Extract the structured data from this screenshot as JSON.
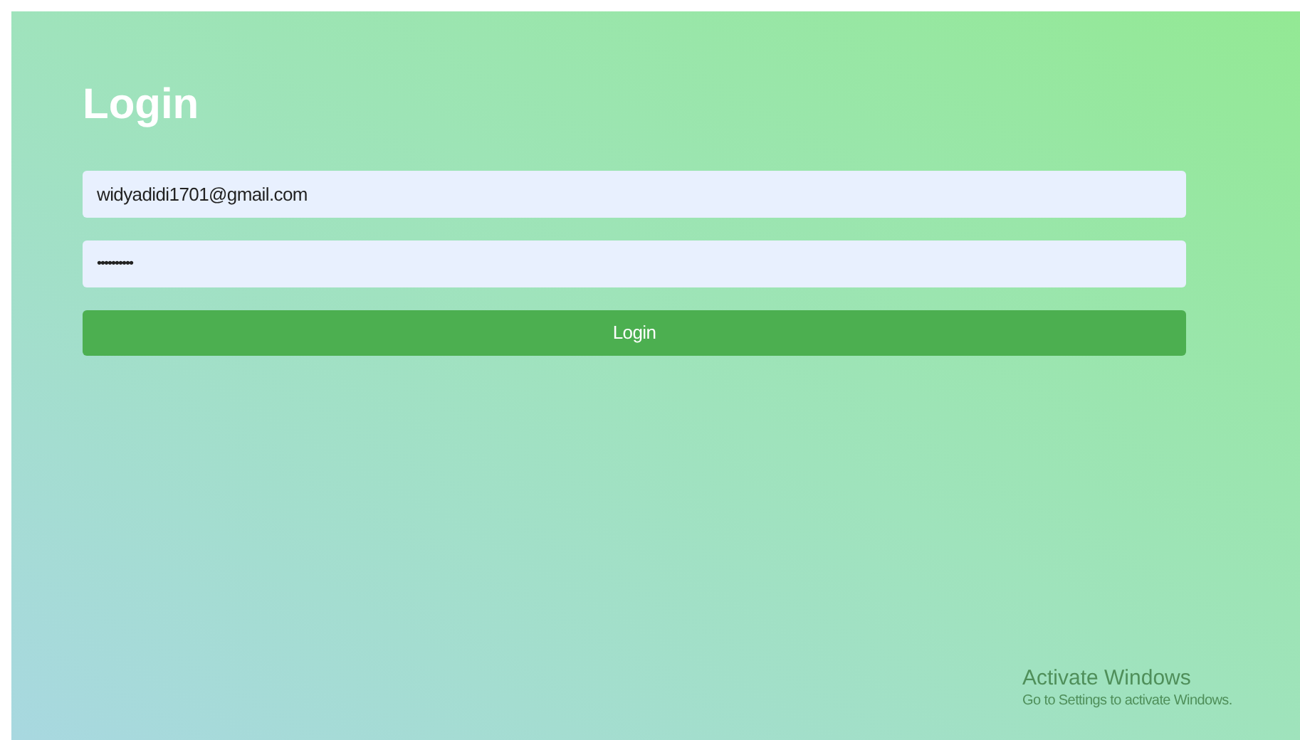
{
  "title": "Login",
  "fields": [
    {
      "kind": "email",
      "value": "widyadidi1701@gmail.com"
    },
    {
      "kind": "password",
      "value": "••••••••••"
    }
  ],
  "button": "Login",
  "os_notice": {
    "title": "Activate Windows",
    "subtitle": "Go to Settings to activate Windows."
  }
}
